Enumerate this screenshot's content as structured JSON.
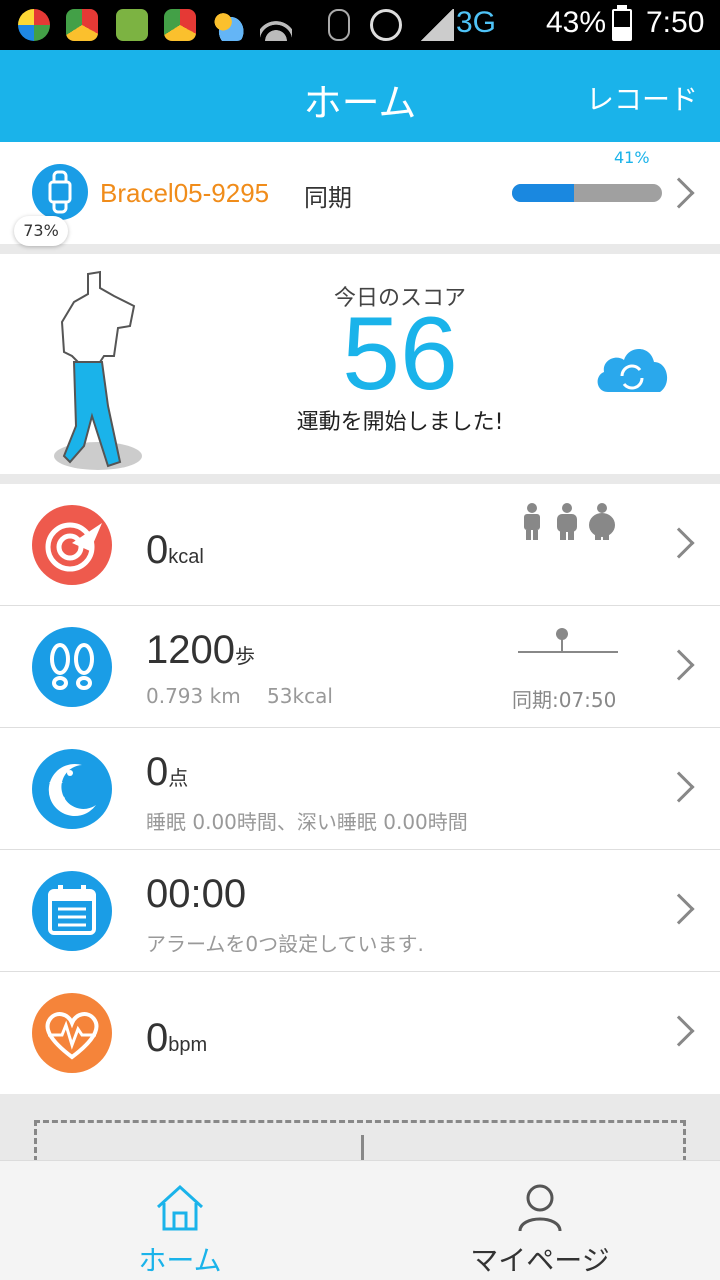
{
  "status_bar": {
    "network": "3G",
    "battery_percent": "43%",
    "battery_level": 0.43,
    "time": "7:50"
  },
  "header": {
    "title": "ホーム",
    "action": "レコード"
  },
  "device": {
    "name": "Bracel05-9295",
    "sync_label": "同期",
    "sync_percent": "41%",
    "sync_progress": 0.41,
    "battery_percent": "73%"
  },
  "score": {
    "title": "今日のスコア",
    "value": "56",
    "message": "運動を開始しました!"
  },
  "metrics": {
    "calories": {
      "value": "0",
      "unit": "kcal"
    },
    "steps": {
      "value": "1200",
      "unit": "歩",
      "distance": "0.793 km",
      "calories": "53kcal",
      "sync_time": "同期:07:50"
    },
    "sleep": {
      "value": "0",
      "unit": "点",
      "detail": "睡眠 0.00時間、深い睡眠 0.00時間"
    },
    "alarm": {
      "value": "00:00",
      "detail": "アラームを0つ設定しています."
    },
    "heart": {
      "value": "0",
      "unit": "bpm"
    }
  },
  "colors": {
    "accent": "#1ab3ea",
    "calories": "#ee5a4d",
    "heart": "#f5843a",
    "device_name": "#f08c1a"
  },
  "nav": {
    "home": "ホーム",
    "mypage": "マイページ"
  }
}
